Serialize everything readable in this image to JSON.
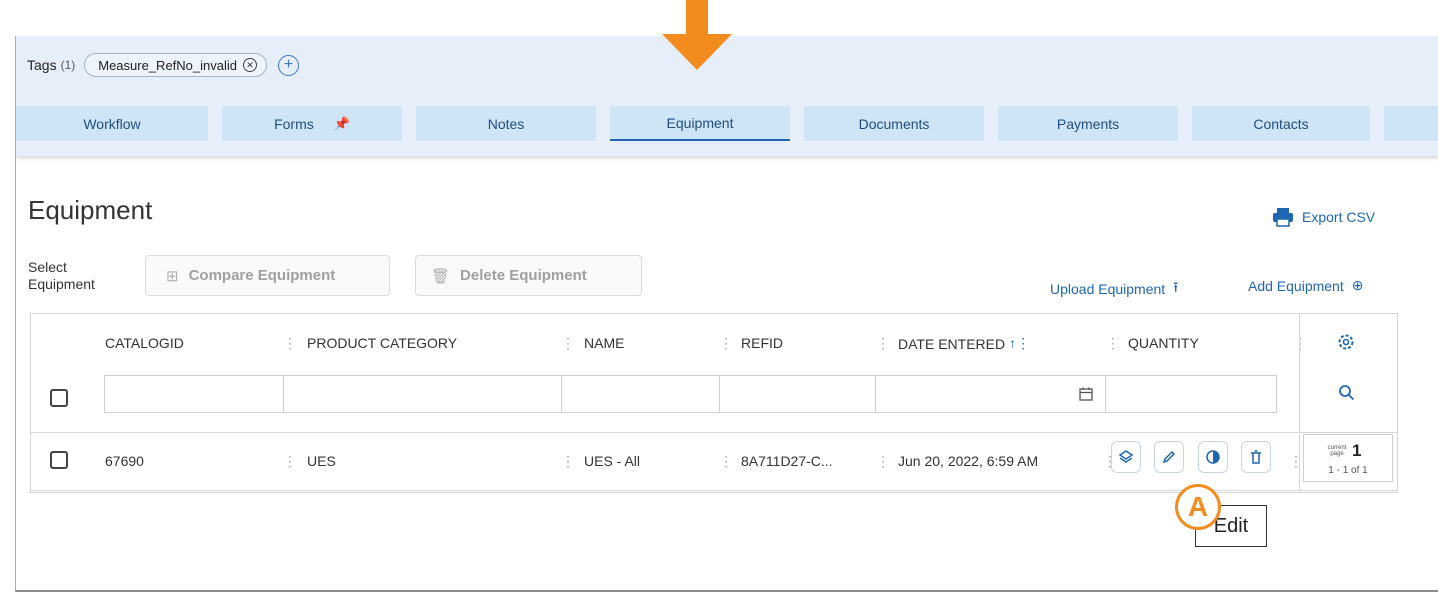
{
  "tags": {
    "title": "Tags",
    "count": "(1)",
    "chips": [
      {
        "label": "Measure_RefNo_invalid"
      }
    ]
  },
  "tabs": [
    {
      "label": "Workflow"
    },
    {
      "label": "Forms"
    },
    {
      "label": "Notes"
    },
    {
      "label": "Equipment",
      "active": true
    },
    {
      "label": "Documents"
    },
    {
      "label": "Payments"
    },
    {
      "label": "Contacts"
    },
    {
      "label": ""
    }
  ],
  "page": {
    "title": "Equipment",
    "export_label": "Export CSV"
  },
  "toolbar": {
    "select_label_line1": "Select",
    "select_label_line2": "Equipment",
    "compare_label": "Compare Equipment",
    "delete_label": "Delete Equipment",
    "upload_label": "Upload Equipment",
    "add_label": "Add Equipment"
  },
  "table": {
    "columns": [
      "CATALOGID",
      "PRODUCT CATEGORY",
      "NAME",
      "REFID",
      "DATE ENTERED",
      "QUANTITY"
    ],
    "rows": [
      {
        "catalogid": "67690",
        "category": "UES",
        "name": "UES - All",
        "refid": "8A711D27-C...",
        "date_entered": "Jun 20, 2022, 6:59 AM"
      }
    ],
    "row_actions": [
      "layers-icon",
      "edit-icon",
      "toggle-icon",
      "trash-icon"
    ]
  },
  "pager": {
    "current_label": "current page",
    "page_number": "1",
    "range": "1 - 1 of 1"
  },
  "annotation": {
    "marker": "A",
    "tooltip": "Edit"
  },
  "colors": {
    "accent": "#1f67b2",
    "tab_bg": "#cfe4f5",
    "header_bg": "#e6eff9",
    "annotation": "#f28c1e"
  }
}
